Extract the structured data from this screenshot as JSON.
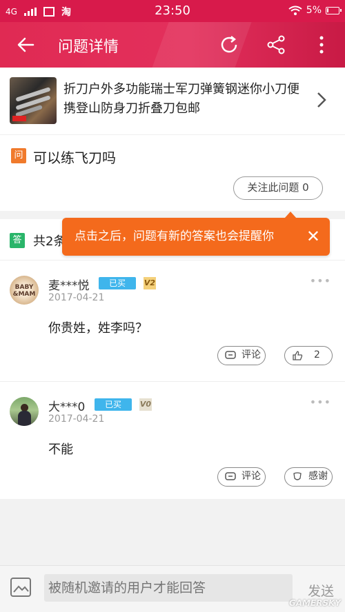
{
  "status_bar": {
    "network": "4G",
    "time": "23:50",
    "battery": "5%"
  },
  "app_bar": {
    "title": "问题详情",
    "back_icon": "arrow-left-icon",
    "refresh_icon": "refresh-icon",
    "share_icon": "share-icon",
    "more_icon": "more-vertical-icon"
  },
  "product": {
    "name": "折刀户外多功能瑞士军刀弹簧钢迷你小刀便携登山防身刀折叠刀包邮"
  },
  "question": {
    "badge": "问",
    "text": "可以练飞刀吗",
    "follow_label": "关注此问题 0"
  },
  "answers_header": {
    "badge": "答",
    "count_text": "共2条"
  },
  "tooltip": {
    "text": "点击之后，问题有新的答案也会提醒你",
    "close": "✕"
  },
  "answers": [
    {
      "user": "麦***悦",
      "bought_tag": "已买",
      "level": "V2",
      "date": "2017-04-21",
      "text": "你贵姓，姓李吗？",
      "comment_label": "评论",
      "like_label": "2",
      "more": "•••"
    },
    {
      "user": "大***0",
      "bought_tag": "已买",
      "level": "V0",
      "date": "2017-04-21",
      "text": "不能",
      "comment_label": "评论",
      "like_label": "感谢",
      "more": "•••"
    }
  ],
  "bottom_bar": {
    "input_placeholder": "被随机邀请的用户才能回答",
    "send_label": "发送"
  },
  "watermark": "GAMERSKY",
  "colors": {
    "brand": "#e02a53",
    "question_badge": "#f07a2c",
    "answer_badge": "#2ab56a",
    "tooltip": "#f46a1c",
    "bought_tag": "#3fb5ec"
  }
}
